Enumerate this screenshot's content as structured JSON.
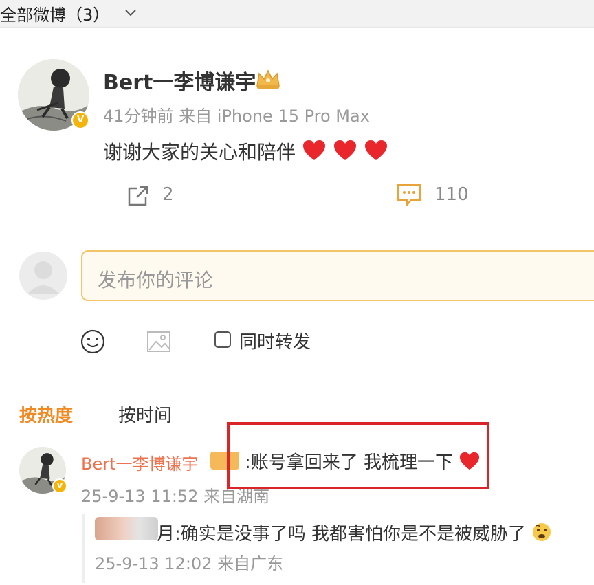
{
  "topbar": {
    "title": "全部微博（3）"
  },
  "post": {
    "username": "Bert一李博谦宇",
    "meta": "41分钟前 来自 iPhone 15 Pro Max",
    "text": "谢谢大家的关心和陪伴",
    "repost_count": "2",
    "comment_count": "110"
  },
  "composer": {
    "placeholder": "发布你的评论",
    "forward_label": "同时转发"
  },
  "sort": {
    "hot": "按热度",
    "time": "按时间"
  },
  "comments": [
    {
      "username": "Bert一李博谦宇",
      "text": ":账号拿回来了 我梳理一下",
      "meta": "25-9-13 11:52 来自湖南"
    }
  ],
  "reply": {
    "text": "月:确实是没事了吗 我都害怕你是不是被威胁了",
    "meta": "25-9-13 12:02 来自广东"
  },
  "colors": {
    "accent": "#eb7350",
    "highlight": "#d9252a",
    "vip": "#f5b40a"
  }
}
